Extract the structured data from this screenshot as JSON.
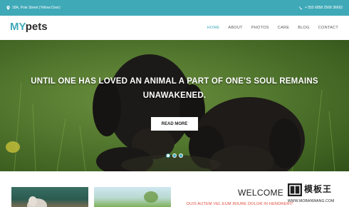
{
  "topbar": {
    "address": "18A, Pole Street (Yellow Door)",
    "phone": "+ 555 6858 2568 36692"
  },
  "header": {
    "logo_my": "MY",
    "logo_pets": "pets",
    "menu": [
      {
        "label": "HOME",
        "active": true
      },
      {
        "label": "ABOUT",
        "active": false
      },
      {
        "label": "PHOTOS",
        "active": false
      },
      {
        "label": "CARE",
        "active": false
      },
      {
        "label": "BLOG",
        "active": false
      },
      {
        "label": "CONTACT",
        "active": false
      }
    ]
  },
  "hero": {
    "headline_line1": "UNTIL ONE HAS LOVED AN ANIMAL A PART OF ONE'S SOUL REMAINS",
    "headline_line2": "UNAWAKENED.",
    "cta_label": "READ MORE",
    "slide_count": 3,
    "active_slide": 1
  },
  "content": {
    "welcome_title": "WELCOME",
    "welcome_sub": "DUIS AUTEM VEL EUM IRIURE DOLOR IN HENDRERIT"
  },
  "watermark": {
    "cn": "模板王",
    "en": "WWW.MOBANWANG.COM"
  },
  "colors": {
    "accent": "#3fa9b8",
    "subtitle_red": "#e04a3a"
  },
  "icons": {
    "address": "map-pin-icon",
    "phone": "phone-icon"
  }
}
